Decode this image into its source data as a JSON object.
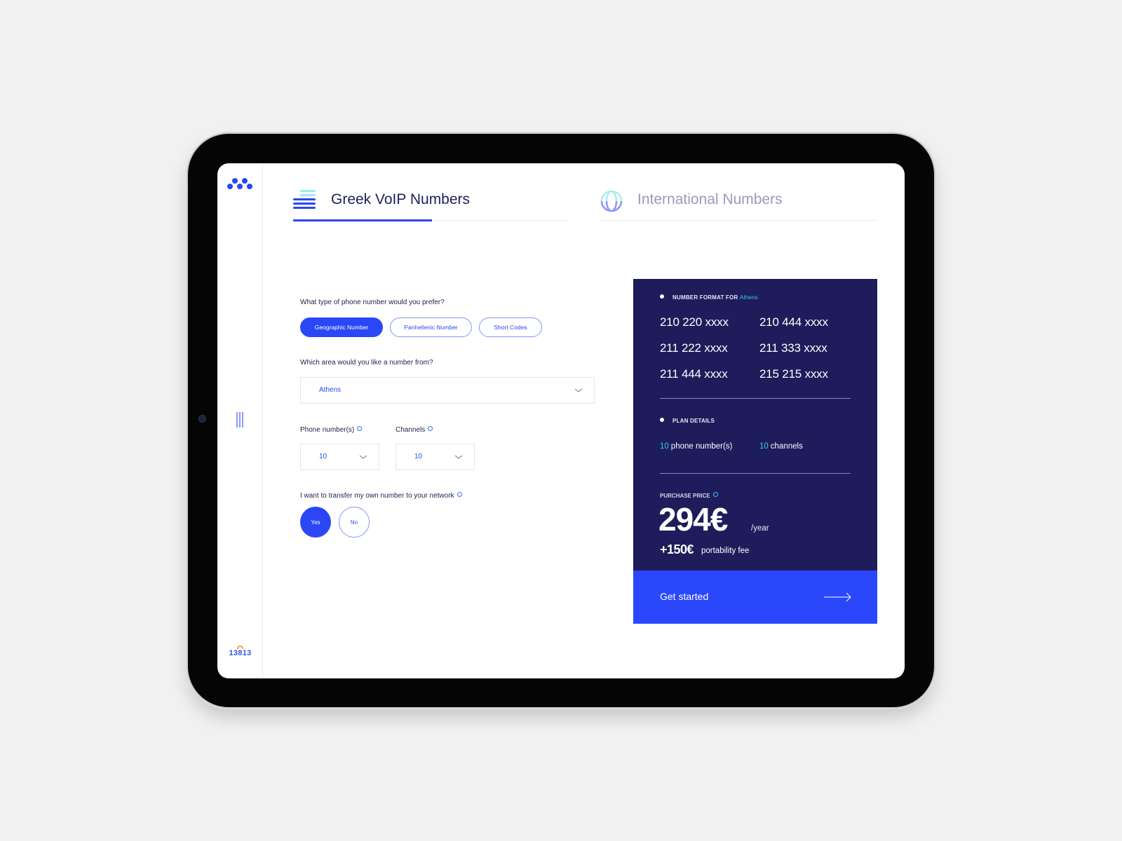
{
  "sidebar": {
    "logo_icon": "dots-logo-icon",
    "menu_icon": "vertical-bars-menu-icon",
    "brand_number": "13813"
  },
  "tabs": [
    {
      "label": "Greek VoIP Numbers",
      "icon": "stacked-lines-icon",
      "active": true
    },
    {
      "label": "International Numbers",
      "icon": "globe-icon",
      "active": false
    }
  ],
  "form": {
    "number_type_question": "What type of phone number would you prefer?",
    "number_types": [
      {
        "label": "Geographic Number",
        "selected": true
      },
      {
        "label": "Panhellenic Number",
        "selected": false
      },
      {
        "label": "Short Codes",
        "selected": false
      }
    ],
    "area_question": "Which area would you like a number from?",
    "area_value": "Athens",
    "phone_numbers_label": "Phone number(s)",
    "phone_numbers_value": "10",
    "channels_label": "Channels",
    "channels_value": "10",
    "transfer_question": "I want to transfer my own number to your network",
    "transfer_options": [
      {
        "label": "Yes",
        "selected": true
      },
      {
        "label": "No",
        "selected": false
      }
    ]
  },
  "summary": {
    "number_format_title": "NUMBER FORMAT FOR",
    "number_format_area": "Athens",
    "number_formats": [
      "210 220 xxxx",
      "210 444 xxxx",
      "211 222 xxxx",
      "211 333 xxxx",
      "211 444 xxxx",
      "215 215 xxxx"
    ],
    "plan_details_title": "PLAN DETAILS",
    "plan_phone_count": "10",
    "plan_phone_label": "phone number(s)",
    "plan_channel_count": "10",
    "plan_channel_label": "channels",
    "purchase_price_label": "PURCHASE PRICE",
    "price": "294€",
    "price_period": "/year",
    "portability_amount": "+150€",
    "portability_label": "portability fee",
    "cta_label": "Get started"
  },
  "colors": {
    "accent": "#2b47f5",
    "card_bg": "#1e1c5b",
    "highlight": "#33d0f0",
    "brand_arc": "#f3a52d"
  }
}
